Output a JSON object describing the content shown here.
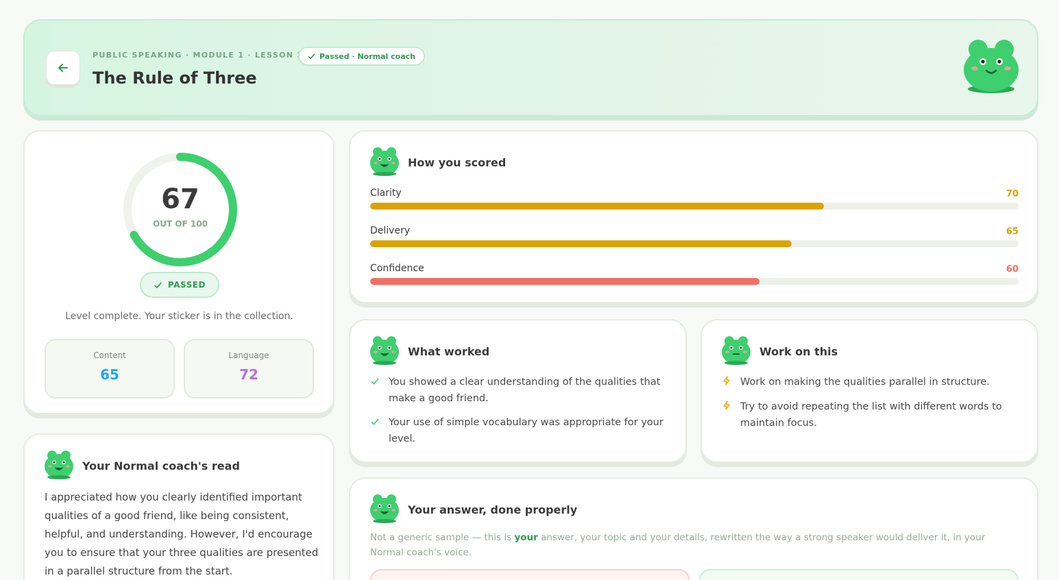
{
  "header": {
    "breadcrumb": "PUBLIC SPEAKING · MODULE 1 · LESSON 3",
    "status_pill": "Passed · Normal coach",
    "title": "The Rule of Three"
  },
  "score": {
    "value": "67",
    "out_of": "OUT OF 100",
    "fraction": 0.67,
    "passed_label": "PASSED",
    "level_message": "Level complete. Your sticker is in the collection.",
    "content_label": "Content",
    "content_value": "65",
    "language_label": "Language",
    "language_value": "72"
  },
  "how_scored": {
    "heading": "How you scored",
    "bars": [
      {
        "label": "Clarity",
        "value": "70",
        "fraction": 0.7,
        "color": "#dca204"
      },
      {
        "label": "Delivery",
        "value": "65",
        "fraction": 0.65,
        "color": "#dca204"
      },
      {
        "label": "Confidence",
        "value": "60",
        "fraction": 0.6,
        "color": "#f56f63"
      }
    ]
  },
  "what_worked": {
    "heading": "What worked",
    "items": [
      "You showed a clear understanding of the qualities that make a good friend.",
      "Your use of simple vocabulary was appropriate for your level."
    ]
  },
  "work_on": {
    "heading": "Work on this",
    "items": [
      "Work on making the qualities parallel in structure.",
      "Try to avoid repeating the list with different words to maintain focus."
    ]
  },
  "coach_read": {
    "heading": "Your Normal coach's read",
    "text": "I appreciated how you clearly identified important qualities of a good friend, like being consistent, helpful, and understanding. However, I'd encourage you to ensure that your three qualities are presented in a parallel structure from the start."
  },
  "answer": {
    "heading": "Your answer, done properly",
    "sub_before": "Not a generic sample — this is ",
    "sub_bold": "your",
    "sub_after": " answer, your topic and your details, rewritten the way a strong speaker would deliver it, in your Normal coach's voice."
  },
  "colors": {
    "accent_green": "#3ecf6e",
    "content_blue": "#1ea7f0",
    "language_purple": "#b46ef0"
  },
  "icons": [
    "back-arrow-icon",
    "check-icon",
    "lightning-icon",
    "frog-mascot-icon"
  ]
}
